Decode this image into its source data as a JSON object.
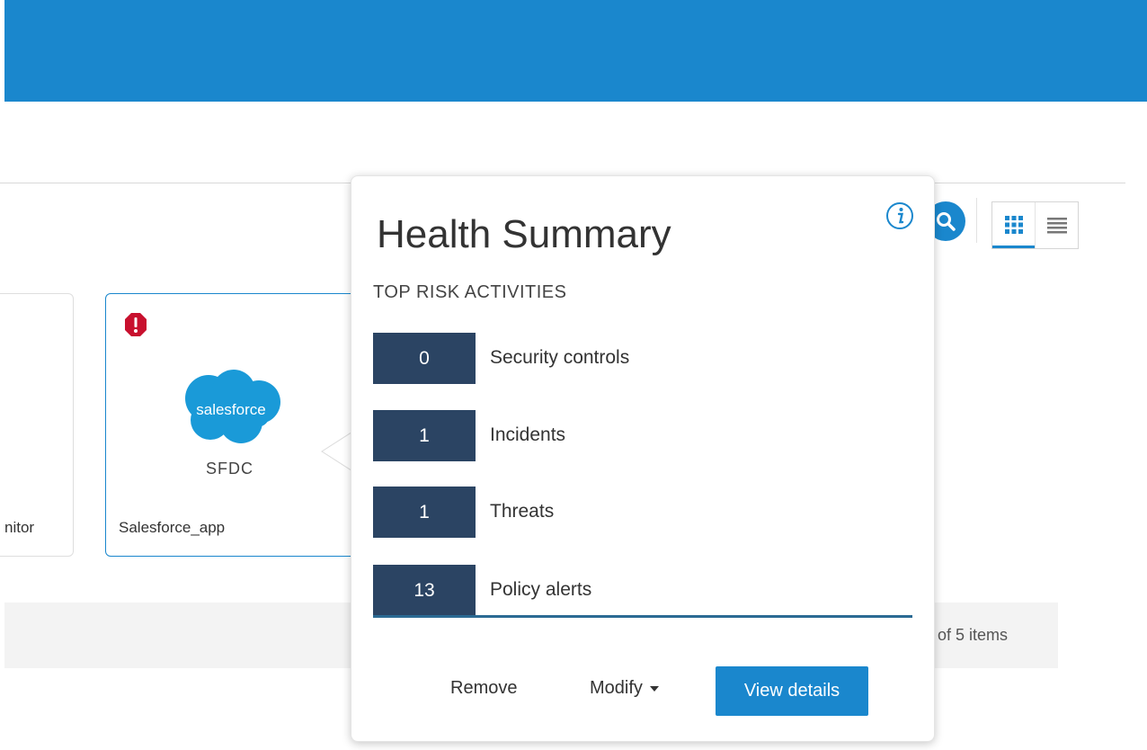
{
  "header": {
    "color": "#1a87cd"
  },
  "toolbar": {
    "search_icon": "search-icon",
    "views": [
      {
        "icon": "grid-view-icon",
        "active": true
      },
      {
        "icon": "list-view-icon",
        "active": false
      }
    ]
  },
  "cards": [
    {
      "label": "nitor"
    },
    {
      "label": "Salesforce_app",
      "abbr": "SFDC",
      "logo_text": "salesforce",
      "status": "alert"
    }
  ],
  "pagination": {
    "text": "of 5 items"
  },
  "health_summary": {
    "title": "Health Summary",
    "subtitle": "TOP RISK ACTIVITIES",
    "info_icon": "info-icon",
    "activities": [
      {
        "count": "0",
        "label": "Security controls"
      },
      {
        "count": "1",
        "label": "Incidents"
      },
      {
        "count": "1",
        "label": "Threats"
      },
      {
        "count": "13",
        "label": "Policy alerts"
      }
    ],
    "actions": {
      "remove": "Remove",
      "modify": "Modify",
      "view_details": "View details"
    }
  },
  "colors": {
    "accent": "#1a87cd",
    "count_box": "#2b4463",
    "alert": "#c8102e"
  }
}
